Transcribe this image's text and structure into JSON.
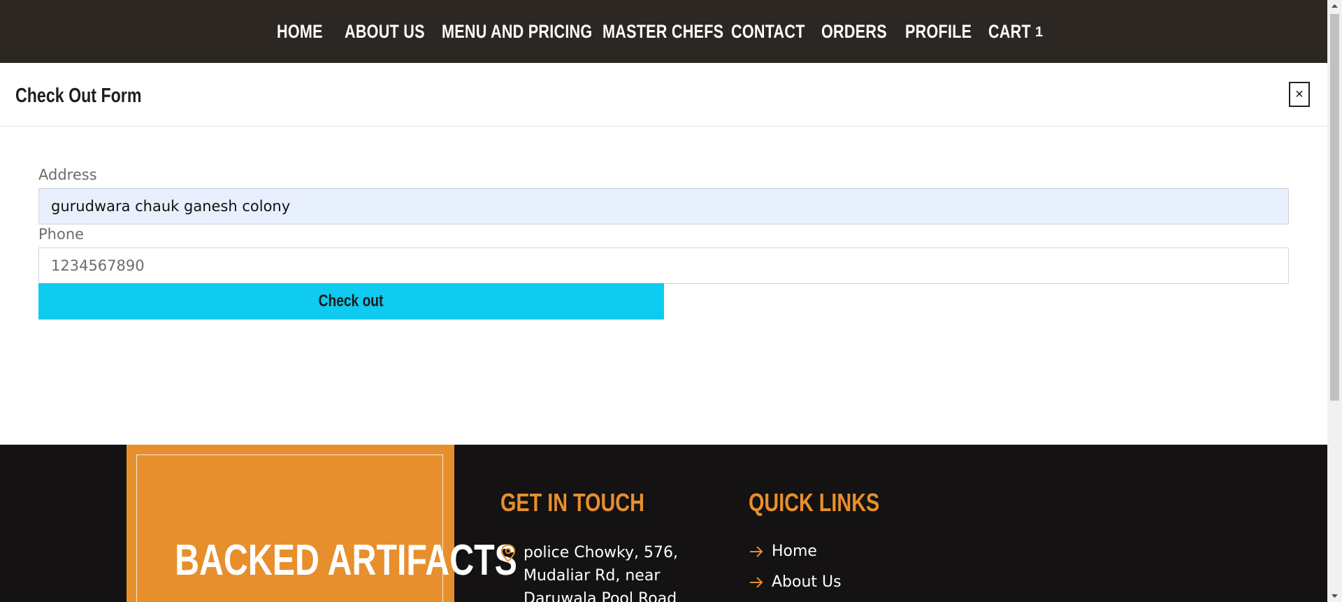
{
  "nav": {
    "items": [
      "HOME",
      "ABOUT US",
      "MENU AND PRICING",
      "MASTER CHEFS",
      "CONTACT",
      "ORDERS",
      "PROFILE",
      "CART"
    ],
    "cart_count": "1"
  },
  "modal": {
    "title": "Check Out Form",
    "close_label": "×"
  },
  "form": {
    "address_label": "Address",
    "address_value": "gurudwara chauk ganesh colony",
    "phone_label": "Phone",
    "phone_placeholder": "1234567890",
    "checkout_label": "Check out"
  },
  "footer": {
    "brand": "BACKED ARTIFACTS",
    "get_in_touch_heading": "GET IN TOUCH",
    "address": "police Chowky, 576, Mudaliar Rd, near Daruwala Pool Road",
    "quick_links_heading": "QUICK LINKS",
    "quick_links": [
      "Home",
      "About Us"
    ]
  },
  "colors": {
    "navbar": "#2c2723",
    "accent": "#e78f2c",
    "button": "#0fcbef",
    "input_filled": "#e8f0fe",
    "footer": "#141212"
  },
  "icons": {
    "contact": "map-pin-icon",
    "link": "arrow-right-icon"
  }
}
